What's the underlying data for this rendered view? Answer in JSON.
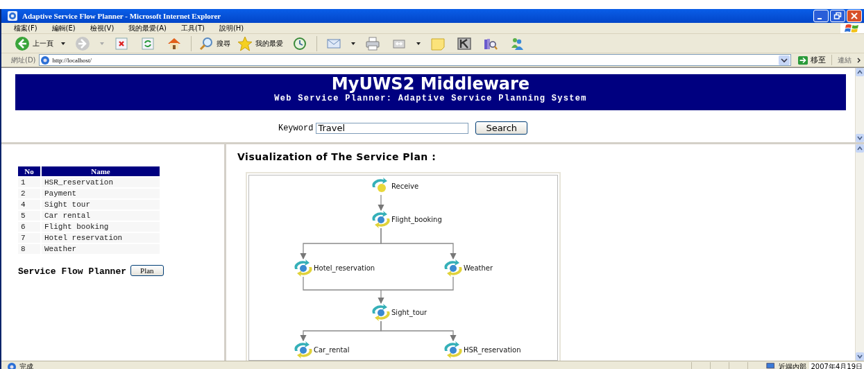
{
  "window": {
    "title": "Adaptive Service Flow Planner - Microsoft Internet Explorer"
  },
  "menu": [
    "檔案(F)",
    "編輯(E)",
    "檢視(V)",
    "我的最愛(A)",
    "工具(T)",
    "說明(H)"
  ],
  "toolbar": {
    "back_label": "上一頁",
    "search_label": "搜尋",
    "favorites_label": "我的最愛"
  },
  "address_bar": {
    "label": "網址(D)",
    "url": "http://localhost/",
    "go_label": "移至",
    "links_label": "連結"
  },
  "banner": {
    "title": "MyUWS2 Middleware",
    "subtitle": "Web Service Planner: Adaptive Service Planning System"
  },
  "search": {
    "label": "Keyword",
    "value": "Travel",
    "button": "Search"
  },
  "services_table": {
    "columns": [
      "No",
      "Name"
    ],
    "rows": [
      [
        "1",
        "HSR_reservation"
      ],
      [
        "2",
        "Payment"
      ],
      [
        "4",
        "Sight tour"
      ],
      [
        "5",
        "Car rental"
      ],
      [
        "6",
        "Flight booking"
      ],
      [
        "7",
        "Hotel reservation"
      ],
      [
        "8",
        "Weather"
      ]
    ]
  },
  "planner": {
    "label": "Service Flow Planner",
    "button": "Plan"
  },
  "plan": {
    "title": "Visualization of The Service Plan :",
    "rows": [
      [
        {
          "label": "Receive",
          "kind": "receive"
        }
      ],
      [
        {
          "label": "Flight_booking",
          "kind": "invoke"
        }
      ],
      [
        {
          "label": "Hotel_reservation",
          "kind": "invoke"
        },
        {
          "label": "Weather",
          "kind": "invoke"
        }
      ],
      [
        {
          "label": "Sight_tour",
          "kind": "invoke"
        }
      ],
      [
        {
          "label": "Car_rental",
          "kind": "invoke"
        },
        {
          "label": "HSR_reservation",
          "kind": "invoke"
        }
      ]
    ]
  },
  "status_bar": {
    "text": "完成",
    "zone": "近端內部",
    "date": "2007年4月19日"
  }
}
